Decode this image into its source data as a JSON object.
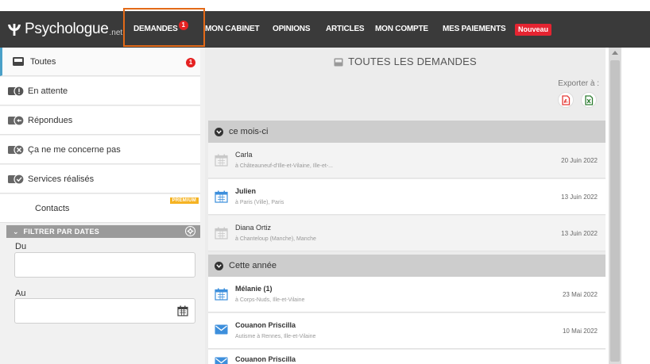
{
  "header": {
    "logo_text": "Psychologue",
    "logo_suffix": ".net",
    "nav": [
      {
        "label": "DEMANDES",
        "badge": "1"
      },
      {
        "label": "MON CABINET"
      },
      {
        "label": "OPINIONS"
      },
      {
        "label": "ARTICLES"
      },
      {
        "label": "MON COMPTE"
      },
      {
        "label": "MES PAIEMENTS"
      }
    ],
    "new_badge": "Nouveau"
  },
  "sidebar": {
    "items": [
      {
        "label": "Toutes",
        "badge": "1",
        "icon": "inbox-icon"
      },
      {
        "label": "En attente",
        "icon": "pending-icon"
      },
      {
        "label": "Répondues",
        "icon": "replied-icon"
      },
      {
        "label": "Ça ne me concerne pas",
        "icon": "not-concerned-icon"
      },
      {
        "label": "Services réalisés",
        "icon": "services-done-icon"
      },
      {
        "label": "Contacts",
        "premium": "PREMIUM"
      }
    ],
    "filter": {
      "title": "FILTRER PAR DATES",
      "from_label": "Du",
      "to_label": "Au",
      "from_value": "",
      "to_value": ""
    }
  },
  "main": {
    "title": "TOUTES LES DEMANDES",
    "export_label": "Exporter à :",
    "sections": [
      {
        "title": "ce mois-ci",
        "rows": [
          {
            "name": "Carla",
            "location": "à Châteauneuf-d'Ille-et-Vilaine, Ille-et-...",
            "date": "20 Juin 2022",
            "state": "read",
            "icon": "calendar-icon"
          },
          {
            "name": "Julien",
            "location": "à Paris (Ville), Paris",
            "date": "13 Juin 2022",
            "state": "unread",
            "icon": "calendar-icon"
          },
          {
            "name": "Diana Ortiz",
            "location": "à Chanteloup (Manche), Manche",
            "date": "13 Juin 2022",
            "state": "read",
            "icon": "calendar-icon"
          }
        ]
      },
      {
        "title": "Cette année",
        "rows": [
          {
            "name": "Mélanie (1)",
            "location": "à Corps-Nuds, Ille-et-Vilaine",
            "date": "23 Mai 2022",
            "state": "unread",
            "icon": "calendar-icon"
          },
          {
            "name": "Couanon Priscilla",
            "location": "Autisme à Rennes, Ille-et-Vilaine",
            "date": "10 Mai 2022",
            "state": "unread",
            "icon": "envelope-icon"
          },
          {
            "name": "Couanon Priscilla",
            "location": "",
            "date": "",
            "state": "unread",
            "icon": "envelope-icon"
          }
        ]
      }
    ]
  },
  "colors": {
    "topbar": "#3a3a3a",
    "accent_red": "#e52222",
    "highlight_orange": "#e36a18",
    "link_blue": "#3d8fdc"
  }
}
